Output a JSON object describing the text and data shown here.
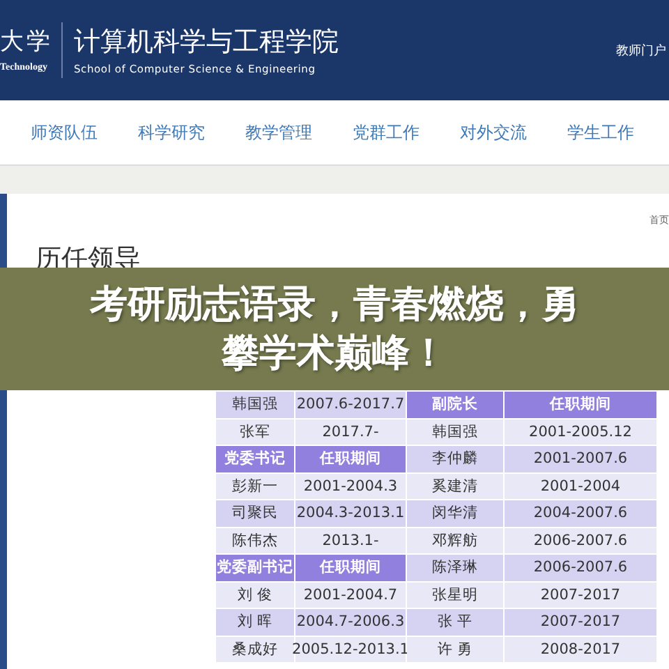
{
  "header": {
    "logo_mark": "大学",
    "logo_sub": "Technology",
    "title": "计算机科学与工程学院",
    "subtitle": "School of Computer Science & Engineering",
    "portal_link": "教师门户"
  },
  "nav": [
    "师资队伍",
    "科学研究",
    "教学管理",
    "党群工作",
    "对外交流",
    "学生工作"
  ],
  "breadcrumb": "首页",
  "page_title": "历任领导",
  "table": {
    "rows": [
      {
        "cells": [
          {
            "text": "韩国强",
            "kind": "data"
          },
          {
            "text": "2007.6-2017.7",
            "kind": "data"
          },
          {
            "text": "副院长",
            "kind": "header"
          },
          {
            "text": "任职期间",
            "kind": "header"
          }
        ]
      },
      {
        "cells": [
          {
            "text": "张军",
            "kind": "data"
          },
          {
            "text": "2017.7-",
            "kind": "data"
          },
          {
            "text": "韩国强",
            "kind": "data"
          },
          {
            "text": "2001-2005.12",
            "kind": "data"
          }
        ]
      },
      {
        "cells": [
          {
            "text": "党委书记",
            "kind": "header"
          },
          {
            "text": "任职期间",
            "kind": "header"
          },
          {
            "text": "李仲麟",
            "kind": "data"
          },
          {
            "text": "2001-2007.6",
            "kind": "data"
          }
        ]
      },
      {
        "cells": [
          {
            "text": "彭新一",
            "kind": "data"
          },
          {
            "text": "2001-2004.3",
            "kind": "data"
          },
          {
            "text": "奚建清",
            "kind": "data"
          },
          {
            "text": "2001-2004",
            "kind": "data"
          }
        ]
      },
      {
        "cells": [
          {
            "text": "司聚民",
            "kind": "data"
          },
          {
            "text": "2004.3-2013.1",
            "kind": "data"
          },
          {
            "text": "闵华清",
            "kind": "data"
          },
          {
            "text": "2004-2007.6",
            "kind": "data"
          }
        ]
      },
      {
        "cells": [
          {
            "text": "陈伟杰",
            "kind": "data"
          },
          {
            "text": "2013.1-",
            "kind": "data"
          },
          {
            "text": "邓辉舫",
            "kind": "data"
          },
          {
            "text": "2006-2007.6",
            "kind": "data"
          }
        ]
      },
      {
        "cells": [
          {
            "text": "党委副书记",
            "kind": "header"
          },
          {
            "text": "任职期间",
            "kind": "header"
          },
          {
            "text": "陈泽琳",
            "kind": "data"
          },
          {
            "text": "2006-2007.6",
            "kind": "data"
          }
        ]
      },
      {
        "cells": [
          {
            "text": "刘 俊",
            "kind": "data"
          },
          {
            "text": "2001-2004.7",
            "kind": "data"
          },
          {
            "text": "张星明",
            "kind": "data"
          },
          {
            "text": "2007-2017",
            "kind": "data"
          }
        ]
      },
      {
        "cells": [
          {
            "text": "刘 晖",
            "kind": "data"
          },
          {
            "text": "2004.7-2006.3",
            "kind": "data"
          },
          {
            "text": "张 平",
            "kind": "data"
          },
          {
            "text": "2007-2017",
            "kind": "data"
          }
        ]
      },
      {
        "cells": [
          {
            "text": "桑成好",
            "kind": "data"
          },
          {
            "text": "2005.12-2013.1",
            "kind": "data"
          },
          {
            "text": "许 勇",
            "kind": "data"
          },
          {
            "text": "2008-2017",
            "kind": "data"
          }
        ]
      }
    ]
  },
  "banner": {
    "text": "考研励志语录，青春燃烧，勇攀学术巅峰！"
  }
}
